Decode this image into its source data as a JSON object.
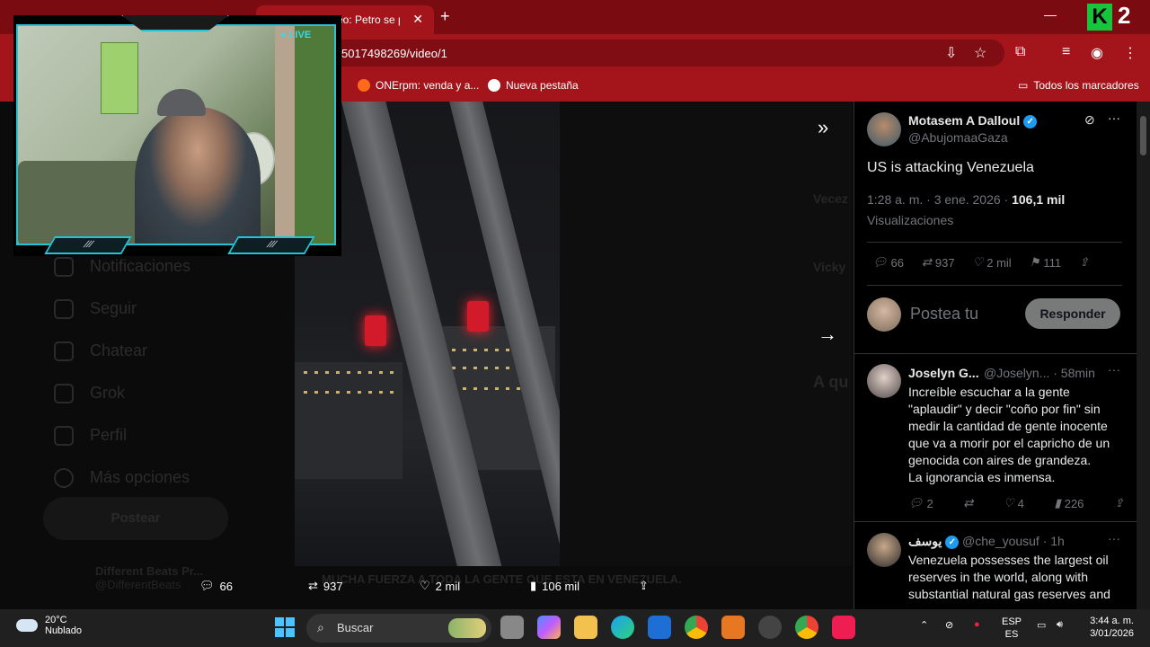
{
  "browser": {
    "tab_title": "eo: Petro se p",
    "url": "5017498269/video/1",
    "bookmarks": [
      {
        "label": "ONErpm: venda y a..."
      },
      {
        "label": "Nueva pestaña"
      }
    ],
    "all_bookmarks": "Todos los marcadores",
    "overlay_badge": "2"
  },
  "webcam": {
    "live_label": "LIVE",
    "bar_left": "/// ",
    "bar_right": "///"
  },
  "sidenav": {
    "items": [
      "Notificaciones",
      "Seguir",
      "Chatear",
      "Grok",
      "Perfil",
      "Más opciones"
    ],
    "post_button": "Postear",
    "profile_name": "Different Beats Pr...",
    "profile_handle": "@DifferentBeats"
  },
  "background": {
    "right_snippets": [
      "Vecez",
      "Vicky",
      "A qu"
    ],
    "caption": "MUCHA FUERZA A TODA LA GENTE QUE ESTA EN VENEZUELA."
  },
  "video_stats": {
    "replies": "66",
    "reposts": "937",
    "likes": "2 mil",
    "views": "106 mil"
  },
  "tweet": {
    "author_name": "Motasem A Dalloul",
    "author_handle": "@AbujomaaGaza",
    "text": "US is attacking Venezuela",
    "time": "1:28 a. m. · 3 ene. 2026 ·",
    "views_count": "106,1 mil",
    "views_label": "Visualizaciones",
    "replies": "66",
    "reposts": "937",
    "likes": "2 mil",
    "bookmarks": "111",
    "reply_placeholder": "Postea tu",
    "reply_button": "Responder"
  },
  "replies": [
    {
      "name": "Joselyn G...",
      "handle": "@Joselyn...",
      "time": "· 58min",
      "text": "Increíble escuchar a la gente \"aplaudir\" y decir \"coño por fin\" sin medir la cantidad de gente inocente que va a morir por el capricho de un genocida con aires de grandeza.",
      "text2": "La ignorancia es inmensa.",
      "replies": "2",
      "likes": "4",
      "views": "226"
    },
    {
      "name": "يوسف",
      "handle": "@che_yousuf",
      "time": "· 1h",
      "text": "Venezuela possesses the largest oil reserves in the world, along with substantial natural gas reserves and"
    }
  ],
  "taskbar": {
    "temperature": "20°C",
    "weather": "Nublado",
    "search_placeholder": "Buscar",
    "lang_top": "ESP",
    "lang_bottom": "ES",
    "time": "3:44 a. m.",
    "date": "3/01/2026"
  },
  "colors": {
    "browser_red": "#a3141b",
    "x_blue": "#1d9bf0",
    "cam_accent": "#24c3d6"
  }
}
